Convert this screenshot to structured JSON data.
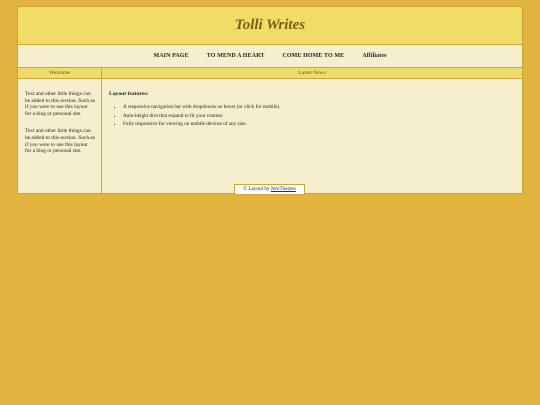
{
  "site": {
    "title": "Tolli Writes"
  },
  "nav": {
    "items": [
      {
        "label": "MAIN PAGE"
      },
      {
        "label": "TO MEND A HEART"
      },
      {
        "label": "COME HOME TO ME"
      },
      {
        "label": "Affiliates"
      }
    ]
  },
  "sidebar": {
    "heading": "Welcome",
    "paragraphs": [
      "Text and other little things can be added to this section. Such as if you were to use this layout for a blog or personal site.",
      "Text and other little things can be added to this section. Such as if you were to use this layout for a blog or personal site."
    ]
  },
  "main": {
    "heading": "Latest News",
    "features_title": "Layout features:",
    "features": [
      "A responsive navigation bar with dropdowns on hover (or click for mobile).",
      "Auto-height divs that expand to fit your content.",
      "Fully responsive for viewing on mobile devices of any size."
    ]
  },
  "footer": {
    "prefix": "© Layout by",
    "link_text": "NeoThemes"
  }
}
